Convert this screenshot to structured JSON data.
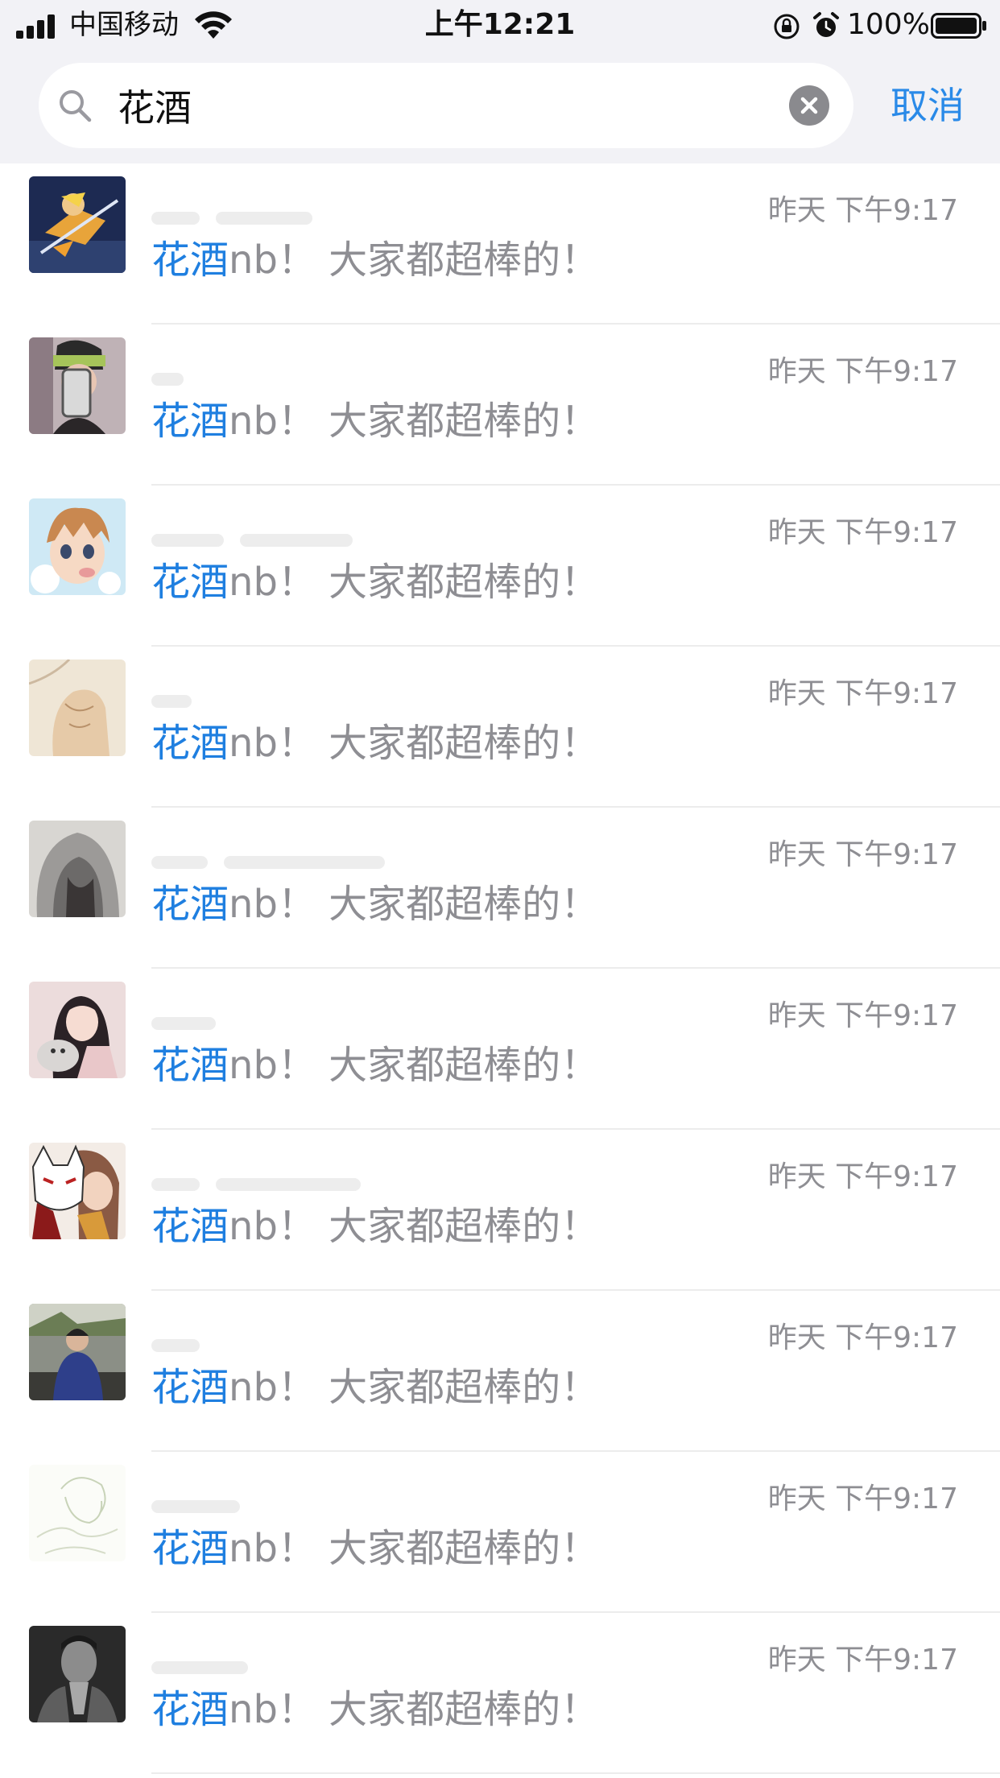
{
  "status_bar": {
    "carrier": "中国移动",
    "time": "上午12:21",
    "battery_percent": "100%",
    "battery_level": 1.0,
    "signal_bars": 4,
    "icons": [
      "signal-icon",
      "wifi-icon",
      "orientation-lock-icon",
      "alarm-icon",
      "battery-icon"
    ]
  },
  "search": {
    "query": "花酒",
    "clear_icon": "clear-circle-icon",
    "search_icon": "search-icon",
    "cancel_label": "取消"
  },
  "colors": {
    "accent": "#2a8ae8",
    "highlight": "#1f7fe0",
    "meta_text": "#8e8e93",
    "header_bg": "#f2f2f6"
  },
  "results": [
    {
      "time": "昨天 下午9:17",
      "highlight": "花酒",
      "rest": "nb！ 大家都超棒的！",
      "avatar": "anime-swordsman-avatar"
    },
    {
      "time": "昨天 下午9:17",
      "highlight": "花酒",
      "rest": "nb！ 大家都超棒的！",
      "avatar": "mirror-selfie-avatar"
    },
    {
      "time": "昨天 下午9:17",
      "highlight": "花酒",
      "rest": "nb！ 大家都超棒的！",
      "avatar": "anime-boy-avatar"
    },
    {
      "time": "昨天 下午9:17",
      "highlight": "花酒",
      "rest": "nb！ 大家都超棒的！",
      "avatar": "sketch-figure-avatar"
    },
    {
      "time": "昨天 下午9:17",
      "highlight": "花酒",
      "rest": "nb！ 大家都超棒的！",
      "avatar": "hooded-person-avatar"
    },
    {
      "time": "昨天 下午9:17",
      "highlight": "花酒",
      "rest": "nb！ 大家都超棒的！",
      "avatar": "girl-with-cat-avatar"
    },
    {
      "time": "昨天 下午9:17",
      "highlight": "花酒",
      "rest": "nb！ 大家都超棒的！",
      "avatar": "fox-mask-anime-avatar"
    },
    {
      "time": "昨天 下午9:17",
      "highlight": "花酒",
      "rest": "nb！ 大家都超棒的！",
      "avatar": "man-outdoor-avatar"
    },
    {
      "time": "昨天 下午9:17",
      "highlight": "花酒",
      "rest": "nb！ 大家都超棒的！",
      "avatar": "line-drawing-avatar"
    },
    {
      "time": "昨天 下午9:17",
      "highlight": "花酒",
      "rest": "nb！ 大家都超棒的！",
      "avatar": "bw-portrait-avatar"
    }
  ]
}
